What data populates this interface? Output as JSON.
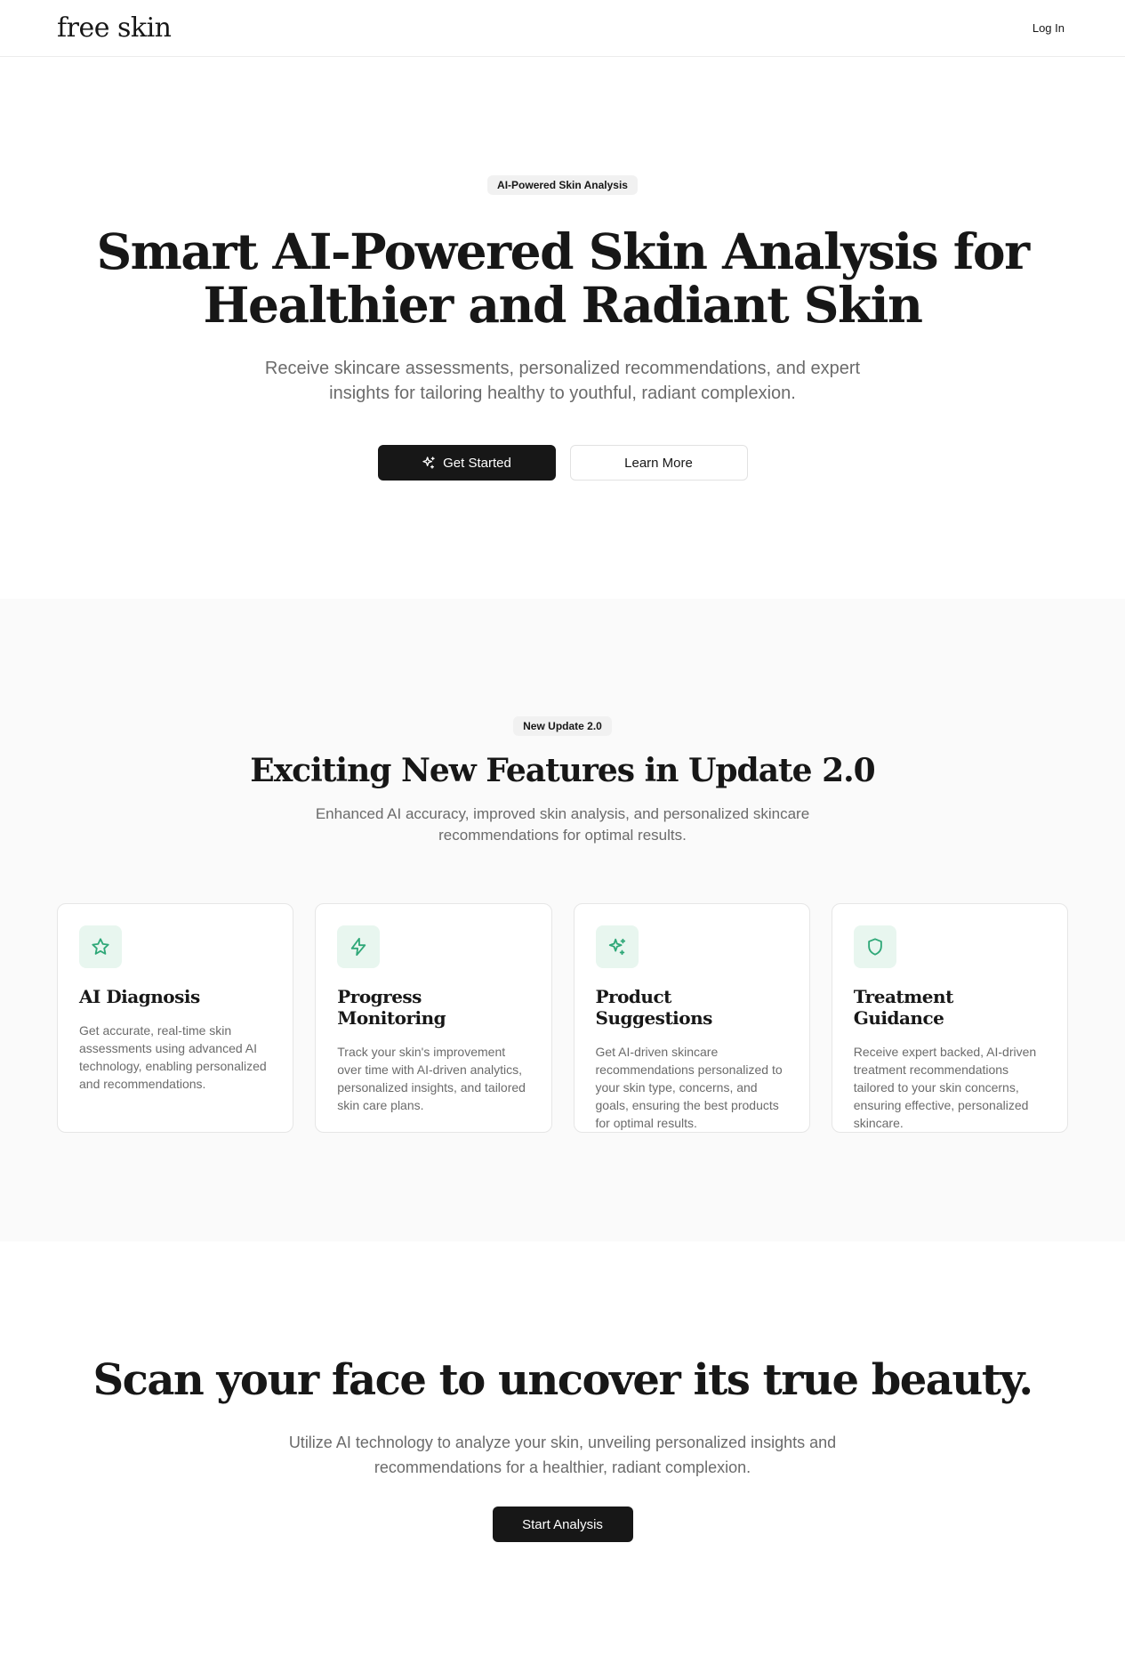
{
  "header": {
    "logo": "free skin",
    "login_label": "Log In"
  },
  "hero": {
    "badge": "AI-Powered Skin Analysis",
    "title": "Smart AI-Powered Skin Analysis for Healthier and Radiant Skin",
    "subtitle": "Receive skincare assessments, personalized recommendations, and expert insights for tailoring healthy to youthful, radiant complexion.",
    "primary_button": "Get Started",
    "secondary_button": "Learn More"
  },
  "features": {
    "badge": "New Update 2.0",
    "title": "Exciting New Features in Update 2.0",
    "subtitle": "Enhanced AI accuracy, improved skin analysis, and personalized skincare recommendations for optimal results.",
    "cards": [
      {
        "icon": "star-icon",
        "title": "AI Diagnosis",
        "text": "Get accurate, real-time skin assessments using advanced AI technology, enabling personalized and recommendations."
      },
      {
        "icon": "lightning-icon",
        "title": "Progress Monitoring",
        "text": "Track your skin's improvement over time with AI-driven analytics, personalized insights, and tailored skin care plans."
      },
      {
        "icon": "sparkles-icon",
        "title": "Product Suggestions",
        "text": "Get AI-driven skincare recommendations personalized to your skin type, concerns, and goals, ensuring the best products for optimal results."
      },
      {
        "icon": "shield-icon",
        "title": "Treatment Guidance",
        "text": "Receive expert backed, AI-driven treatment recommendations tailored to your skin concerns, ensuring effective, personalized skincare."
      }
    ]
  },
  "cta": {
    "title": "Scan your face to uncover its true beauty.",
    "subtitle": "Utilize AI technology to analyze your skin, unveiling personalized insights and recommendations for a healthier, radiant complexion.",
    "button": "Start Analysis"
  },
  "colors": {
    "accent": "#2fa878",
    "accent_bg": "#e8f6ef",
    "dark": "#171717",
    "muted_text": "#6b6b6b",
    "section_bg": "#fafafa"
  }
}
